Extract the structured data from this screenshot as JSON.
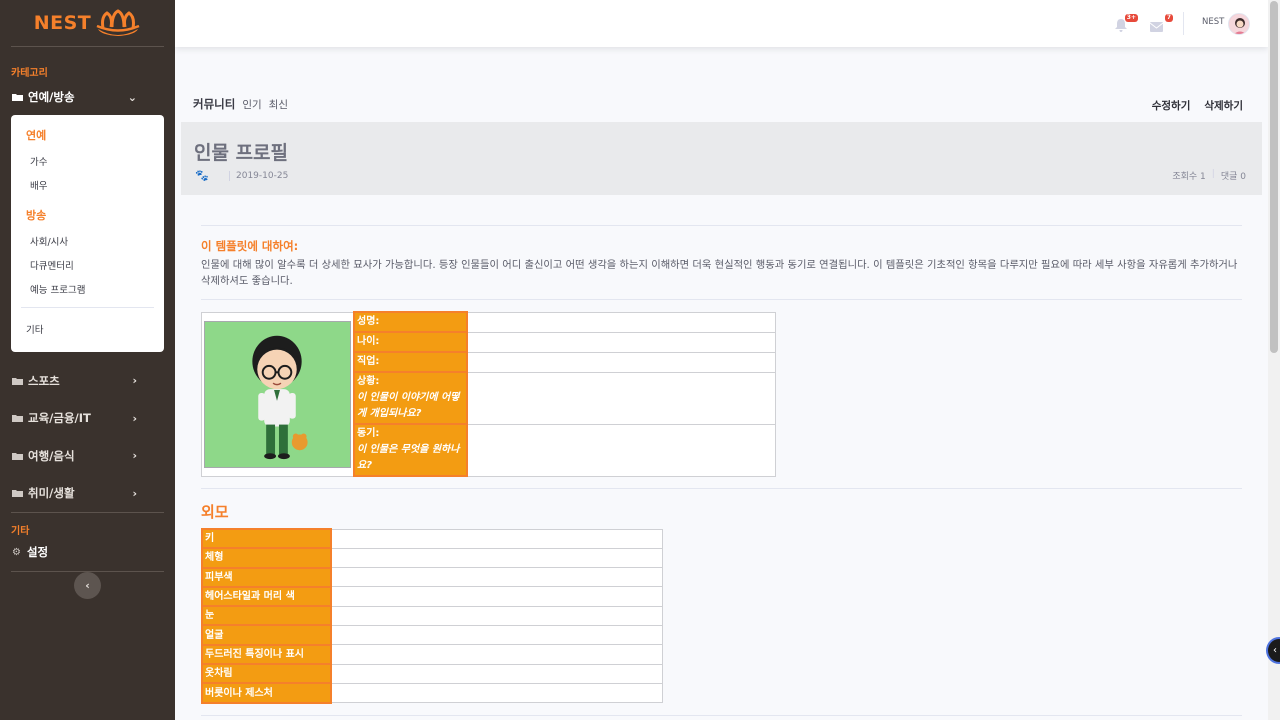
{
  "brand": {
    "name": "NEST"
  },
  "sidebar": {
    "category_heading": "카테고리",
    "categories": [
      {
        "label": "연예/방송",
        "expanded": true
      },
      {
        "label": "스포츠"
      },
      {
        "label": "교육/금융/IT"
      },
      {
        "label": "여행/음식"
      },
      {
        "label": "취미/생활"
      }
    ],
    "submenu": {
      "group1_heading": "연예",
      "group1_items": [
        "가수",
        "배우"
      ],
      "group2_heading": "방송",
      "group2_items": [
        "사회/시사",
        "다큐멘터리",
        "예능 프로그램"
      ],
      "other": "기타"
    },
    "other_heading": "기타",
    "settings_label": "설정"
  },
  "topbar": {
    "alerts_badge": "3+",
    "messages_badge": "7",
    "username": "NEST"
  },
  "breadcrumb": {
    "main": "커뮤니티",
    "tabs": [
      "인기",
      "최신"
    ]
  },
  "actions": {
    "edit": "수정하기",
    "delete": "삭제하기"
  },
  "post": {
    "title": "인물 프로필",
    "date": "2019-10-25",
    "views": "조회수 1",
    "comments": "댓글 0"
  },
  "about": {
    "title": "이 템플릿에 대하여:",
    "text": "인물에 대해 많이 알수록 더 상세한 묘사가 가능합니다. 등장 인물들이 어디 출신이고 어떤 생각을 하는지 이해하면 더욱 현실적인 행동과 동기로 연결됩니다. 이 템플릿은 기초적인 항목을 다루지만 필요에 따라 세부 사항을 자유롭게 추가하거나 삭제하셔도 좋습니다."
  },
  "profile_table": {
    "name": "성명:",
    "age": "나이:",
    "job": "직업:",
    "situation": "상황:",
    "situation_q": "이 인물이 이야기에 어떻게 개입되나요?",
    "motive": "동기:",
    "motive_q": "이 인물은 무엇을 원하나요?"
  },
  "appearance": {
    "title": "외모",
    "rows": [
      "키",
      "체형",
      "피부색",
      "헤어스타일과 머리 색",
      "눈",
      "얼굴",
      "두드러진 특징이나 표시",
      "옷차림",
      "버릇이나 제스처"
    ]
  },
  "colors": {
    "accent": "#f5802b",
    "sidebar": "#3a322d",
    "label_bg": "#f39c12"
  }
}
